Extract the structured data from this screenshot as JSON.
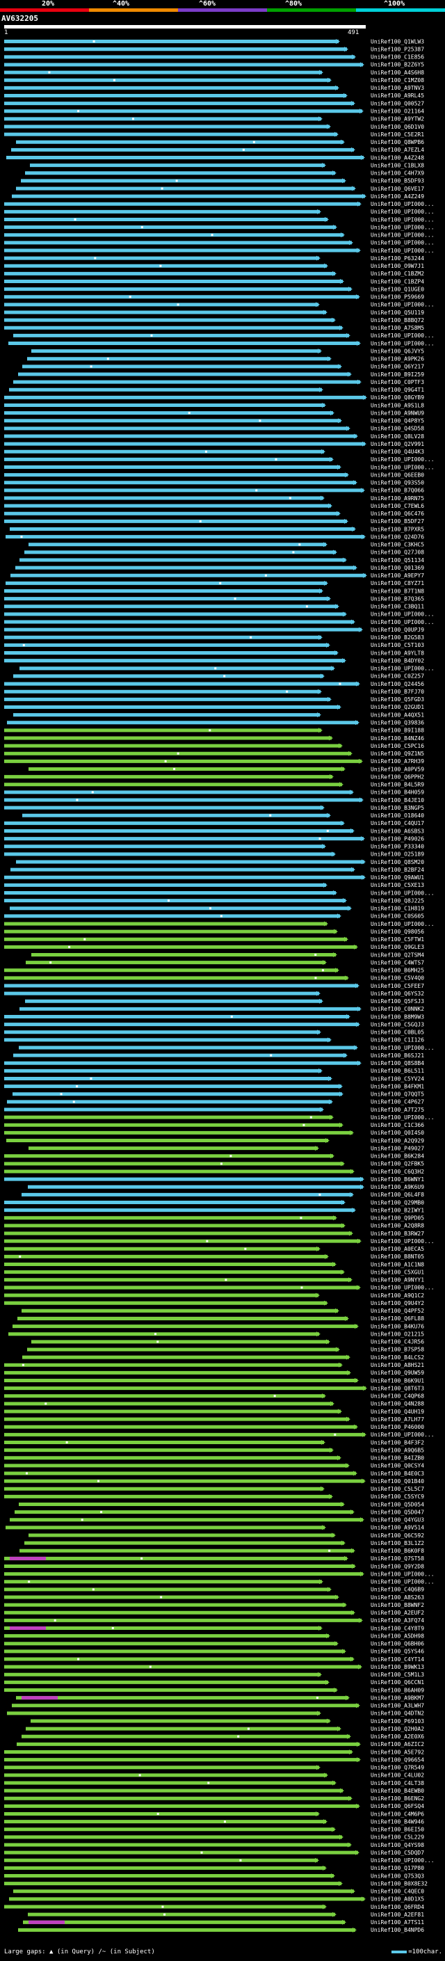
{
  "scale": {
    "ticks": [
      "20%",
      "^40%",
      "^60%",
      "^80%",
      "^100%"
    ],
    "colors": [
      "#e8000f",
      "#f08a00",
      "#7c3cc8",
      "#00a000",
      "#00d0d8"
    ]
  },
  "query": {
    "id": "AV632205",
    "start": "1",
    "end": "491"
  },
  "hit_colors": {
    "cyan": "#5bc8e8",
    "green": "#7ad040",
    "magenta": "#c040c0",
    "dark_green": "#2c6c1c",
    "dot": "#ffffff"
  },
  "hits": [
    "UniRef100_Q1WLW3",
    "UniRef100_P25387",
    "UniRef100_C1E856",
    "UniRef100_B2Z6Y5",
    "UniRef100_A4S6H8",
    "UniRef100_C1MZ08",
    "UniRef100_A9TNV3",
    "UniRef100_A9RL45",
    "UniRef100_Q00527",
    "UniRef100_O21164",
    "UniRef100_A9YTW2",
    "UniRef100_Q6D1V0",
    "UniRef100_C5E2R1",
    "UniRef100_Q8WPB6",
    "UniRef100_A7EZL4",
    "UniRef100_A4Z248",
    "UniRef100_C1BLX8",
    "UniRef100_C4H7X9",
    "UniRef100_B5DF93",
    "UniRef100_Q6VE17",
    "UniRef100_A4Z249",
    "UniRef100_UPI000...",
    "UniRef100_UPI000...",
    "UniRef100_UPI000...",
    "UniRef100_UPI000...",
    "UniRef100_UPI000...",
    "UniRef100_UPI000...",
    "UniRef100_UPI000...",
    "UniRef100_P63244",
    "UniRef100_O9W7J1",
    "UniRef100_C1BZM2",
    "UniRef100_C1BZP4",
    "UniRef100_Q1UGE0",
    "UniRef100_P59669",
    "UniRef100_UPI000...",
    "UniRef100_Q5U119",
    "UniRef100_B8BQ72",
    "UniRef100_A7S8M5",
    "UniRef100_UPI000...",
    "UniRef100_UPI000...",
    "UniRef100_Q6JVY5",
    "UniRef100_A9PK26",
    "UniRef100_Q6Y217",
    "UniRef100_B9I259",
    "UniRef100_C0PTF3",
    "UniRef100_Q9G4T1",
    "UniRef100_Q8GYB9",
    "UniRef100_A9S1L8",
    "UniRef100_A9NWU9",
    "UniRef100_Q4P8Y5",
    "UniRef100_Q4SD58",
    "UniRef100_Q8LV28",
    "UniRef100_Q2V991",
    "UniRef100_Q4U4K3",
    "UniRef100_UPI000...",
    "UniRef100_UPI000...",
    "UniRef100_Q6EEB0",
    "UniRef100_Q93S50",
    "UniRef100_B7Q066",
    "UniRef100_A9RN75",
    "UniRef100_C7EWL6",
    "UniRef100_Q6C476",
    "UniRef100_B5DF27",
    "UniRef100_B7PXR5",
    "UniRef100_Q24D76",
    "UniRef100_C3KHC5",
    "UniRef100_Q27J08",
    "UniRef100_Q51134",
    "UniRef100_Q01369",
    "UniRef100_A9EPY7",
    "UniRef100_C8YZ71",
    "UniRef100_B7T1N8",
    "UniRef100_B7Q365",
    "UniRef100_C3BQ11",
    "UniRef100_UPI000...",
    "UniRef100_UPI000...",
    "UniRef100_Q0UPJ9",
    "UniRef100_B2G583",
    "UniRef100_C5T103",
    "UniRef100_A9YLT8",
    "UniRef100_B4DY02",
    "UniRef100_UPI000...",
    "UniRef100_C0Z257",
    "UniRef100_Q24456",
    "UniRef100_B7FJ70",
    "UniRef100_Q5FGD3",
    "UniRef100_Q2GUD1",
    "UniRef100_A4QX51",
    "UniRef100_Q39836",
    "UniRef100_B9I188",
    "UniRef100_B4NZ46",
    "UniRef100_C5PC16",
    "UniRef100_Q9Z1N5",
    "UniRef100_A7RH39",
    "UniRef100_A0PV59",
    "UniRef100_Q6PPH2",
    "UniRef100_B4L5R9",
    "UniRef100_B4H059",
    "UniRef100_B4JE10",
    "UniRef100_B3NGP5",
    "UniRef100_O18640",
    "UniRef100_C4QU17",
    "UniRef100_A6SBS3",
    "UniRef100_P49026",
    "UniRef100_P33340",
    "UniRef100_O25189",
    "UniRef100_Q8SM20",
    "UniRef100_B2BF24",
    "UniRef100_Q9AWU1",
    "UniRef100_C5XE13",
    "UniRef100_UPI000...",
    "UniRef100_Q8J225",
    "UniRef100_C1H819",
    "UniRef100_C0S605",
    "UniRef100_UPI000...",
    "UniRef100_Q98056",
    "UniRef100_C5FTW1",
    "UniRef100_Q9GLE3",
    "UniRef100_Q2TSM4",
    "UniRef100_C4WTS7",
    "UniRef100_B6MH25",
    "UniRef100_C5V4Q0",
    "UniRef100_C5FEE7",
    "UniRef100_Q6YS32",
    "UniRef100_Q5FSJ3",
    "UniRef100_C0NNK2",
    "UniRef100_B8M9W3",
    "UniRef100_C5GQJ3",
    "UniRef100_C0BL05",
    "UniRef100_C1I126",
    "UniRef100_UPI000...",
    "UniRef100_B6SJ21",
    "UniRef100_Q8S8B4",
    "UniRef100_B6L511",
    "UniRef100_C5YV24",
    "UniRef100_B4FKM1",
    "UniRef100_Q7QQT5",
    "UniRef100_C4P627",
    "UniRef100_A7T275",
    "UniRef100_UPI000...",
    "UniRef100_C1C366",
    "UniRef100_Q0I4S0",
    "UniRef100_A2Q929",
    "UniRef100_P49027",
    "UniRef100_B6K284",
    "UniRef100_Q2FBK5",
    "UniRef100_C6Q3H2",
    "UniRef100_B6WNY1",
    "UniRef100_A9K6U9",
    "UniRef100_Q6L4F8",
    "UniRef100_Q29MB0",
    "UniRef100_B2IWY1",
    "UniRef100_Q9PD05",
    "UniRef100_A2Q8R8",
    "UniRef100_B3RW27",
    "UniRef100_UPI000...",
    "UniRef100_A0ECA5",
    "UniRef100_B8NT05",
    "UniRef100_A1C1N8",
    "UniRef100_C5XGU1",
    "UniRef100_A9NYY1",
    "UniRef100_UPI000...",
    "UniRef100_A9Q1C2",
    "UniRef100_Q9U4Y2",
    "UniRef100_Q4PF52",
    "UniRef100_Q6FL88",
    "UniRef100_B4KU76",
    "UniRef100_O21215",
    "UniRef100_C4JR56",
    "UniRef100_B7SP58",
    "UniRef100_B4LCS2",
    "UniRef100_A8HS21",
    "UniRef100_Q9UW59",
    "UniRef100_B6K9U1",
    "UniRef100_Q8T6T3",
    "UniRef100_C4QP68",
    "UniRef100_Q4N288",
    "UniRef100_Q4UH19",
    "UniRef100_A7LH77",
    "UniRef100_P46000",
    "UniRef100_UPI000...",
    "UniRef100_B4F3F2",
    "UniRef100_A9Q6B5",
    "UniRef100_B4IZB0",
    "UniRef100_Q0CSY4",
    "UniRef100_B4E0C3",
    "UniRef100_Q01B40",
    "UniRef100_C5L5C7",
    "UniRef100_C5SYC9",
    "UniRef100_Q5D054",
    "UniRef100_Q5D047",
    "UniRef100_Q4YGU3",
    "UniRef100_A9V514",
    "UniRef100_Q6C592",
    "UniRef100_B3L1Z2",
    "UniRef100_B6K0F8",
    "UniRef100_Q7ST58",
    "UniRef100_Q9Y2D8",
    "UniRef100_UPI000...",
    "UniRef100_UPI000...",
    "UniRef100_C4Q6B9",
    "UniRef100_A8S263",
    "UniRef100_B8WNF2",
    "UniRef100_A2EUF2",
    "UniRef100_A3FQ74",
    "UniRef100_C4Y8T9",
    "UniRef100_A5DH98",
    "UniRef100_Q6BH06",
    "UniRef100_Q5YS46",
    "UniRef100_C4YT14",
    "UniRef100_B9WK13",
    "UniRef100_C5M1L3",
    "UniRef100_Q6CCN1",
    "UniRef100_B6AH09",
    "UniRef100_A9BKM7",
    "UniRef100_A3LWH7",
    "UniRef100_Q4DTN2",
    "UniRef100_P69103",
    "UniRef100_Q2H0A2",
    "UniRef100_A2E0X6",
    "UniRef100_A6ZIC2",
    "UniRef100_A5E792",
    "UniRef100_Q96654",
    "UniRef100_Q7R549",
    "UniRef100_C4LU02",
    "UniRef100_C4LT38",
    "UniRef100_B4EWB0",
    "UniRef100_B6ENG2",
    "UniRef100_Q6FSQ4",
    "UniRef100_C4M6P6",
    "UniRef100_B4W946",
    "UniRef100_B6EI50",
    "UniRef100_C5L229",
    "UniRef100_Q4YS98",
    "UniRef100_C5DQD7",
    "UniRef100_UPI000...",
    "UniRef100_Q17P80",
    "UniRef100_Q753Q3",
    "UniRef100_B0X8E32",
    "UniRef100_C4QEC0",
    "UniRef100_A0D1X5",
    "UniRef100_Q6FRD4",
    "UniRef100_A2EF81",
    "UniRef100_A7TS11",
    "UniRef100_B4NPD6"
  ],
  "footer": {
    "large_gaps_label": "Large gaps:",
    "query_gap": "(in Query)",
    "subject_gap": "/~ (in Subject)",
    "scale_label": "=100char."
  }
}
